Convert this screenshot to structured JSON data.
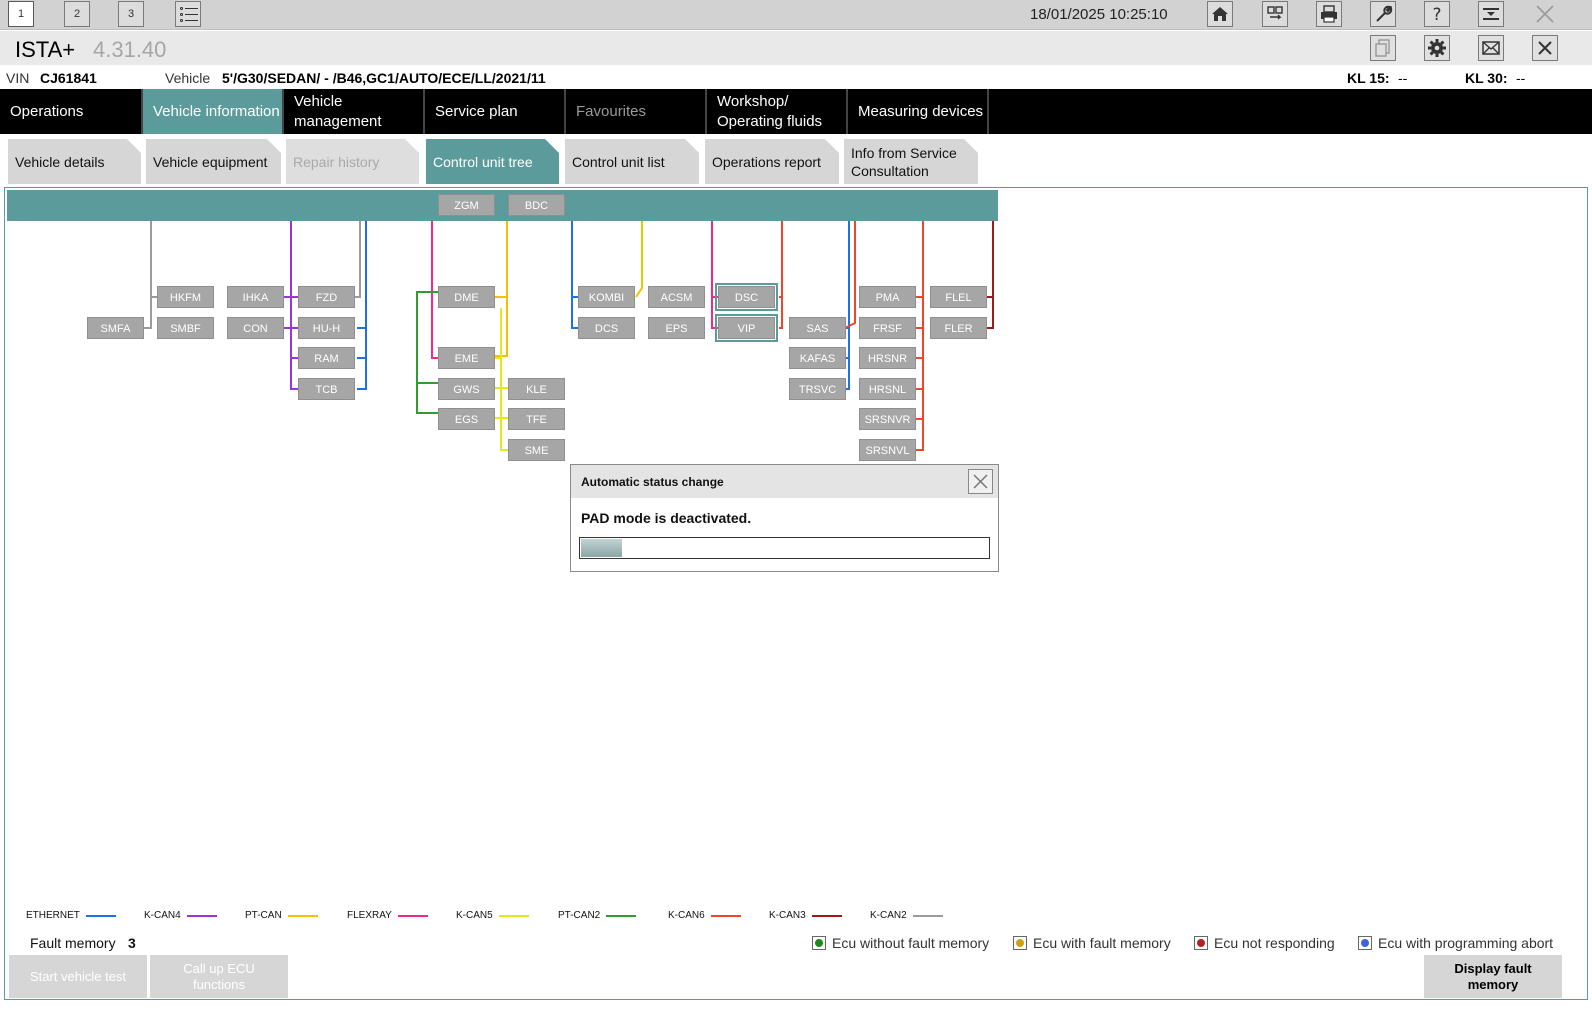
{
  "topbar": {
    "workspaces": [
      "1",
      "2",
      "3"
    ],
    "datetime": "18/01/2025 10:25:10",
    "icons": [
      "home-icon",
      "dealer-data-icon",
      "print-icon",
      "wrench-icon",
      "help-icon",
      "minimize-icon",
      "close-icon"
    ]
  },
  "title": {
    "name": "ISTA+",
    "version": "4.31.40"
  },
  "vehicle": {
    "vin_label": "VIN",
    "vin": "CJ61841",
    "vehicle_label": "Vehicle",
    "vehicle_value": "5'/G30/SEDAN/ - /B46,GC1/AUTO/ECE/LL/2021/11",
    "kl15_label": "KL 15:",
    "kl15_value": "--",
    "kl30_label": "KL 30:",
    "kl30_value": "--"
  },
  "main_nav": [
    {
      "label": "Operations"
    },
    {
      "label": "Vehicle information"
    },
    {
      "label": "Vehicle management"
    },
    {
      "label": "Service plan"
    },
    {
      "label": "Favourites"
    },
    {
      "label": "Workshop/ Operating fluids"
    },
    {
      "label": "Measuring devices"
    }
  ],
  "sub_tabs": [
    {
      "label": "Vehicle details"
    },
    {
      "label": "Vehicle equipment"
    },
    {
      "label": "Repair history"
    },
    {
      "label": "Control unit tree"
    },
    {
      "label": "Control unit list"
    },
    {
      "label": "Operations report"
    },
    {
      "label": "Info from Service Consultation"
    }
  ],
  "ecus": [
    "ZGM",
    "BDC",
    "HKFM",
    "IHKA",
    "FZD",
    "SMFA",
    "SMBF",
    "CON",
    "HU-H",
    "RAM",
    "TCB",
    "DME",
    "EME",
    "GWS",
    "EGS",
    "KLE",
    "TFE",
    "SME",
    "KOMBI",
    "ACSM",
    "DSC",
    "DCS",
    "EPS",
    "VIP",
    "SAS",
    "KAFAS",
    "TRSVC",
    "PMA",
    "FRSF",
    "HRSNR",
    "HRSNL",
    "SRSNVR",
    "SRSNVL",
    "FLEL",
    "FLER"
  ],
  "colors": {
    "ETHERNET": "#1f6fe5",
    "K-CAN4": "#9b35d6",
    "PT-CAN": "#f2c200",
    "FLEXRAY": "#f0288c",
    "K-CAN5": "#e3ea1a",
    "PT-CAN2": "#2f9d2f",
    "K-CAN6": "#f0452a",
    "K-CAN3": "#a01818",
    "K-CAN2": "#9b9b9b",
    "accent": "#5b9b9b"
  },
  "legend": [
    "ETHERNET",
    "K-CAN4",
    "PT-CAN",
    "FLEXRAY",
    "K-CAN5",
    "PT-CAN2",
    "K-CAN6",
    "K-CAN3",
    "K-CAN2"
  ],
  "fault_memory": {
    "label": "Fault memory",
    "count": "3"
  },
  "status_legend": [
    {
      "label": "Ecu without fault memory",
      "color": "#1c8a1c"
    },
    {
      "label": "Ecu with fault memory",
      "color": "#c9a21c"
    },
    {
      "label": "Ecu not responding",
      "color": "#b12222"
    },
    {
      "label": "Ecu with programming abort",
      "color": "#3d63d6"
    }
  ],
  "buttons": {
    "start_test": "Start vehicle test",
    "call_ecu": "Call up ECU functions",
    "display_fault": "Display fault memory"
  },
  "dialog": {
    "title": "Automatic status change",
    "message": "PAD mode is deactivated.",
    "progress": 0.1
  }
}
